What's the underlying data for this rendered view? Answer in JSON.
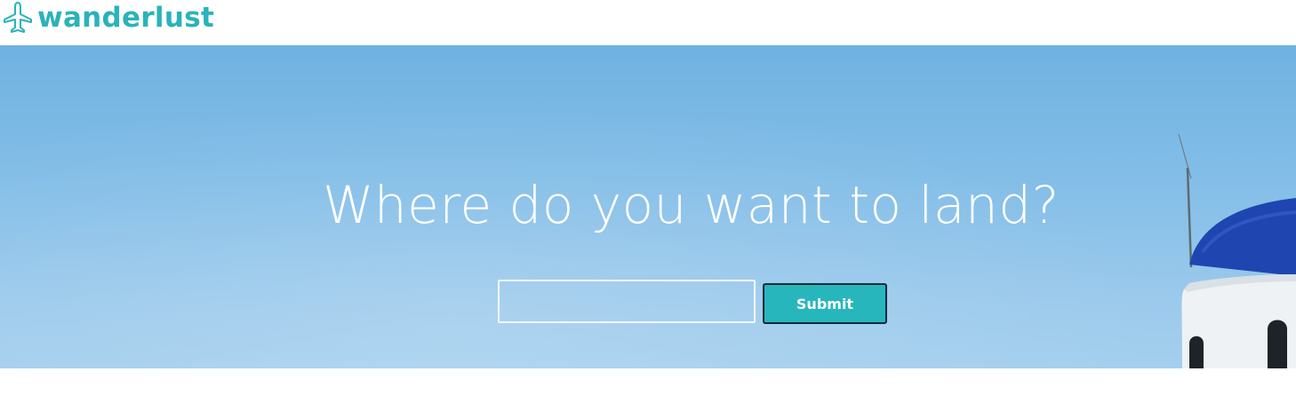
{
  "header": {
    "brand_name": "wanderlust",
    "logo_icon": "airplane-icon"
  },
  "hero": {
    "headline": "Where do you want to land?",
    "search": {
      "value": "",
      "placeholder": ""
    },
    "submit_label": "Submit",
    "background_image": "blue-sky-with-church-dome"
  },
  "colors": {
    "brand": "#2ab3b8",
    "button": "#28b6bd",
    "sky_top": "#6fb2e1",
    "sky_bottom": "#a4cfee",
    "dome": "#1f45b0"
  }
}
